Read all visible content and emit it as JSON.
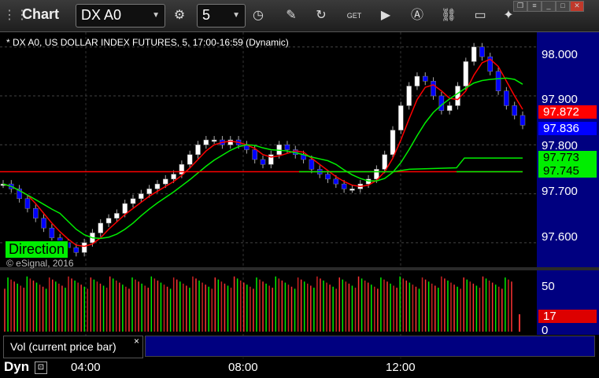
{
  "toolbar": {
    "app_title": "Chart",
    "symbol": "DX A0",
    "interval": "5",
    "icons": [
      "settings-icon",
      "clock-icon",
      "pencil-icon",
      "refresh-icon",
      "get-icon",
      "play-icon",
      "a-icon",
      "link-icon",
      "comment-icon",
      "twitter-icon"
    ]
  },
  "chart": {
    "subtitle": "* DX A0, US DOLLAR INDEX FUTURES, 5, 17:00-16:59 (Dynamic)",
    "copyright": "© eSignal, 2016",
    "direction_label": "Direction",
    "price_ticks": [
      "98.000",
      "97.900",
      "97.800",
      "97.700",
      "97.600"
    ],
    "badges": {
      "red_price": "97.872",
      "blue_price": "97.836",
      "green_upper": "97.773",
      "green_lower": "97.745"
    },
    "colors": {
      "bull": "#ffffff",
      "bear": "#0000ff",
      "red_line": "#ff0000",
      "green_line": "#00ee00",
      "axis_bg": "#000080"
    }
  },
  "volume": {
    "label": "Vol (current price bar)",
    "close_glyph": "×",
    "ticks": [
      "50",
      "0"
    ],
    "badge": "17"
  },
  "footer": {
    "mode": "Dyn",
    "time_ticks": [
      "04:00",
      "08:00",
      "12:00"
    ]
  },
  "chart_data": {
    "type": "candlestick",
    "y_axis_range": [
      97.55,
      98.03
    ],
    "price_ticks": [
      98.0,
      97.9,
      97.8,
      97.7,
      97.6
    ],
    "price_series": [
      97.72,
      97.71,
      97.69,
      97.67,
      97.65,
      97.63,
      97.61,
      97.6,
      97.59,
      97.58,
      97.6,
      97.62,
      97.64,
      97.65,
      97.66,
      97.68,
      97.69,
      97.7,
      97.71,
      97.72,
      97.73,
      97.74,
      97.76,
      97.78,
      97.8,
      97.81,
      97.81,
      97.8,
      97.81,
      97.8,
      97.79,
      97.77,
      97.76,
      97.78,
      97.8,
      97.79,
      97.78,
      97.77,
      97.75,
      97.74,
      97.73,
      97.72,
      97.71,
      97.71,
      97.72,
      97.73,
      97.75,
      97.78,
      97.83,
      97.88,
      97.92,
      97.94,
      97.93,
      97.9,
      97.87,
      97.88,
      97.92,
      97.97,
      98.0,
      97.98,
      97.95,
      97.91,
      97.88,
      97.86,
      97.84
    ],
    "red_ma_last": 97.872,
    "green_ma_last": 97.836,
    "green_step_levels": [
      97.745,
      97.773
    ],
    "red_flat_level": 97.745,
    "volume_ticks": [
      50,
      0
    ],
    "volume_last": 17
  }
}
